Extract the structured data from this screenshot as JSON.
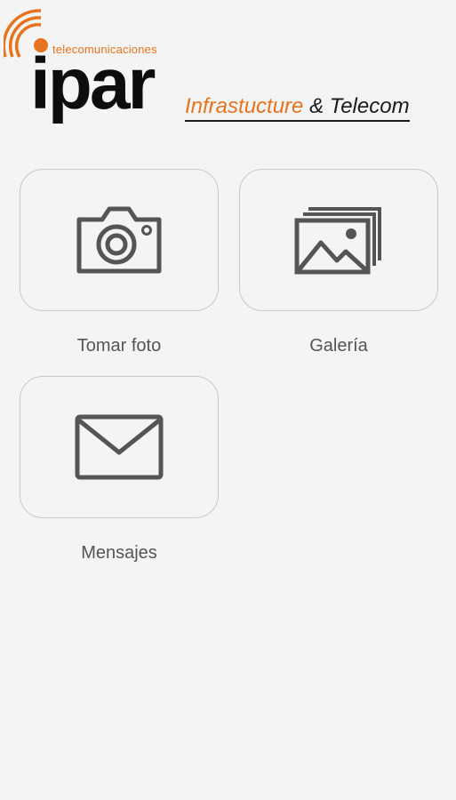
{
  "header": {
    "logo_sub": "telecomunicaciones",
    "logo_word": "ipar",
    "tagline_accent": "Infrastucture",
    "tagline_rest": " & Telecom"
  },
  "tiles": [
    {
      "label": "Tomar foto",
      "icon": "camera-icon"
    },
    {
      "label": "Galería",
      "icon": "gallery-icon"
    },
    {
      "label": "Mensajes",
      "icon": "mail-icon"
    }
  ],
  "colors": {
    "accent": "#e8731f",
    "icon": "#555555",
    "background": "#f4f4f4"
  }
}
